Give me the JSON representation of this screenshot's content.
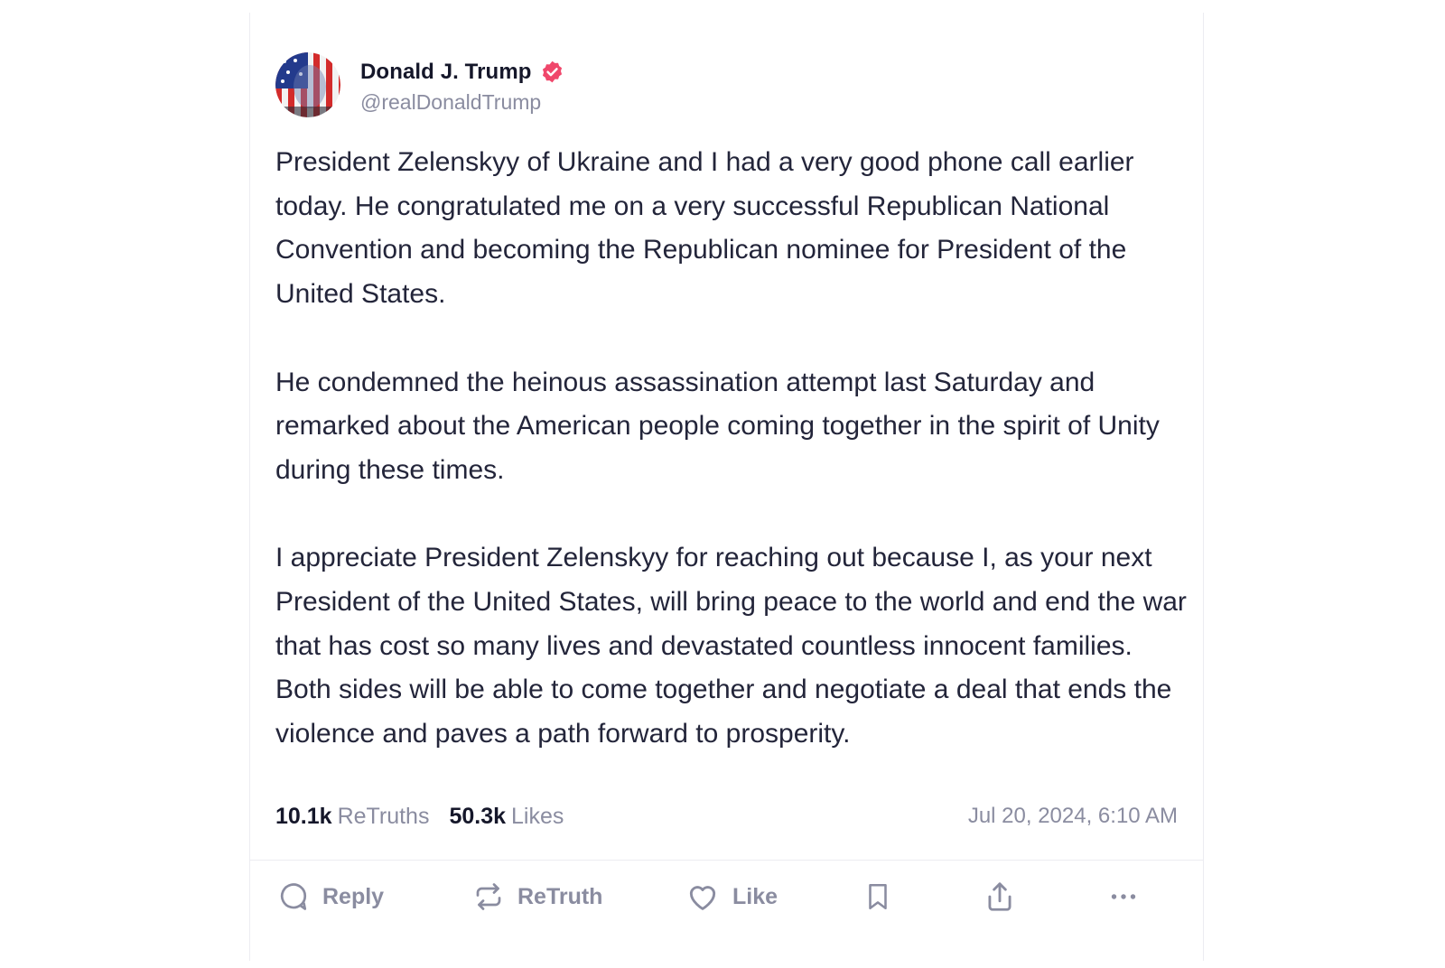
{
  "post": {
    "author": {
      "display_name": "Donald J. Trump",
      "handle": "@realDonaldTrump",
      "verified_color": "#f0476b"
    },
    "paragraphs": [
      "President Zelenskyy of Ukraine and I had a very good phone call earlier today. He congratulated me on a very successful Republican National Convention and becoming the Republican nominee for President of the United States.",
      "He condemned the heinous assassination attempt last Saturday and remarked about the American people coming together in the spirit of Unity during these times.",
      "I appreciate President Zelenskyy for reaching out because I, as your next President of the United States, will bring peace to the world and end the war that has cost so many lives and devastated countless innocent families. Both sides will be able to come together and negotiate a deal that ends the violence and paves a path forward to prosperity."
    ],
    "stats": {
      "retruths_count": "10.1k",
      "retruths_label": "ReTruths",
      "likes_count": "50.3k",
      "likes_label": "Likes"
    },
    "timestamp": "Jul 20, 2024, 6:10 AM"
  },
  "actions": {
    "reply_label": "Reply",
    "retruth_label": "ReTruth",
    "like_label": "Like"
  },
  "icons": [
    "verified-badge-icon",
    "reply-icon",
    "retruth-icon",
    "heart-icon",
    "bookmark-icon",
    "share-icon",
    "more-icon"
  ]
}
